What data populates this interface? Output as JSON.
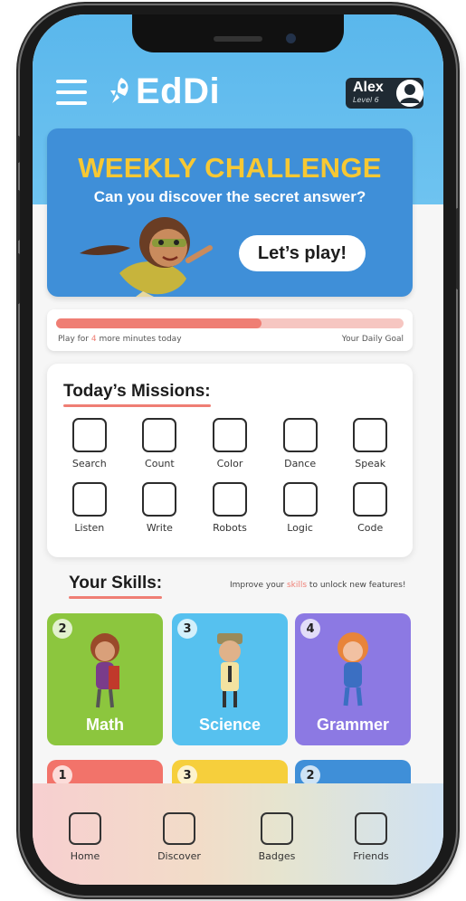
{
  "header": {
    "app_name": "EdDi",
    "user_name": "Alex",
    "user_level": "Level 6"
  },
  "challenge": {
    "title": "WEEKLY CHALLENGE",
    "subtitle": "Can you discover the secret answer?",
    "button_label": "Let’s play!"
  },
  "goal": {
    "text_prefix": "Play for ",
    "minutes": "4",
    "text_suffix": " more minutes today",
    "right_label": "Your Daily Goal",
    "progress_fraction": 0.59
  },
  "missions": {
    "title": "Today’s Missions:",
    "items": [
      "Search",
      "Count",
      "Color",
      "Dance",
      "Speak",
      "Listen",
      "Write",
      "Robots",
      "Logic",
      "Code"
    ]
  },
  "skills": {
    "title": "Your Skills:",
    "hint_prefix": "Improve your ",
    "hint_highlight": "skills",
    "hint_suffix": " to unlock new features!",
    "cards": [
      {
        "level": "2",
        "name": "Math",
        "color": "#8cc63e"
      },
      {
        "level": "3",
        "name": "Science",
        "color": "#56c1ef"
      },
      {
        "level": "4",
        "name": "Grammer",
        "color": "#8c79e3"
      },
      {
        "level": "1",
        "name": "",
        "color": "#f2736a"
      },
      {
        "level": "3",
        "name": "",
        "color": "#f6cf3c"
      },
      {
        "level": "2",
        "name": "",
        "color": "#3f8fd8"
      }
    ]
  },
  "bottom_nav": {
    "items": [
      "Home",
      "Discover",
      "Badges",
      "Friends"
    ]
  },
  "colors": {
    "accent": "#ef7e74",
    "challenge_bg": "#3f8fd8",
    "challenge_title": "#f7c833",
    "header_bg": "#5ab7ec"
  }
}
